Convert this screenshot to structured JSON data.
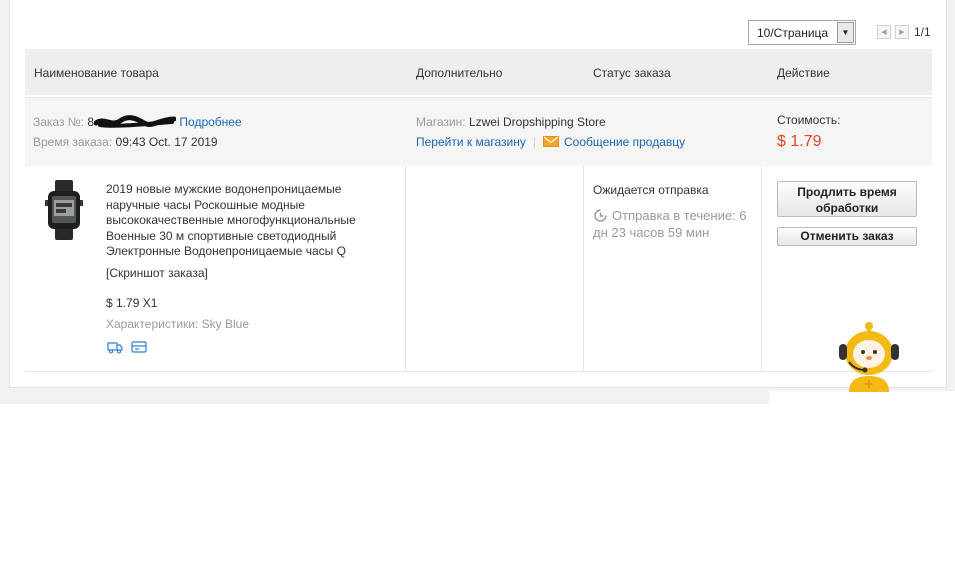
{
  "pager": {
    "per_page": "10/Страница",
    "page_count": "1/1"
  },
  "table_header": {
    "product": "Наименование товара",
    "additional": "Дополнительно",
    "status": "Статус заказа",
    "action": "Действие"
  },
  "order": {
    "number_label": "Заказ №:",
    "number_visible": "8",
    "details_link": "Подробнее",
    "time_label": "Время заказа:",
    "time_value": "09:43 Oct. 17 2019",
    "store_label": "Магазин:",
    "store_name": "Lzwei Dropshipping Store",
    "goto_store": "Перейти к магазину",
    "separator": "|",
    "message_seller": "Сообщение продавцу",
    "cost_label": "Стоимость:",
    "cost_value": "$ 1.79"
  },
  "product": {
    "title": "2019 новые мужские водонепроницаемые наручные часы Роскошные модные высококачественные многофункциональные Военные 30 м спортивные светодиодный Электронные Водонепроницаемые часы Q",
    "screenshot": "[Скриншот заказа]",
    "price_qty": "$ 1.79 X1",
    "specs": "Характеристики: Sky Blue",
    "icons": [
      "delivery-truck-icon",
      "payment-card-icon"
    ]
  },
  "status": {
    "text": "Ожидается отправка",
    "shipping_time": "Отправка в течение: 6 дн 23 часов 59 мин"
  },
  "actions": {
    "extend": "Продлить время обработки",
    "cancel": "Отменить заказ"
  },
  "colors": {
    "link": "#1a66b3",
    "price": "#e8461e",
    "mascot": "#f5b915"
  }
}
